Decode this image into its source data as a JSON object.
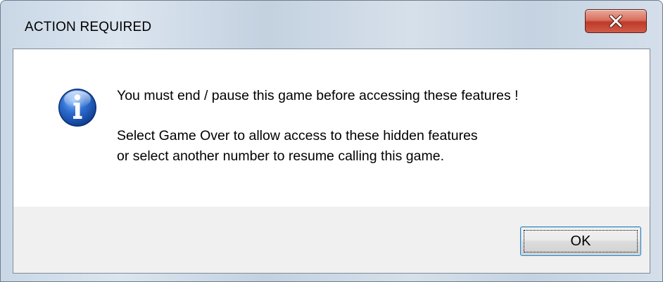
{
  "window": {
    "title": "ACTION REQUIRED"
  },
  "icons": {
    "close": "close-icon",
    "info": "information-icon"
  },
  "message": {
    "line1": "You must end / pause this game before accessing these features !",
    "line2": "Select Game Over to allow access to these hidden features",
    "line3": "or select another number to resume calling this game."
  },
  "buttons": {
    "ok_label": "OK"
  },
  "colors": {
    "close_button": "#c0392b",
    "info_icon": "#1f5bb8",
    "focus_border": "#3c7fb1",
    "footer_background": "#f0f0f0"
  }
}
